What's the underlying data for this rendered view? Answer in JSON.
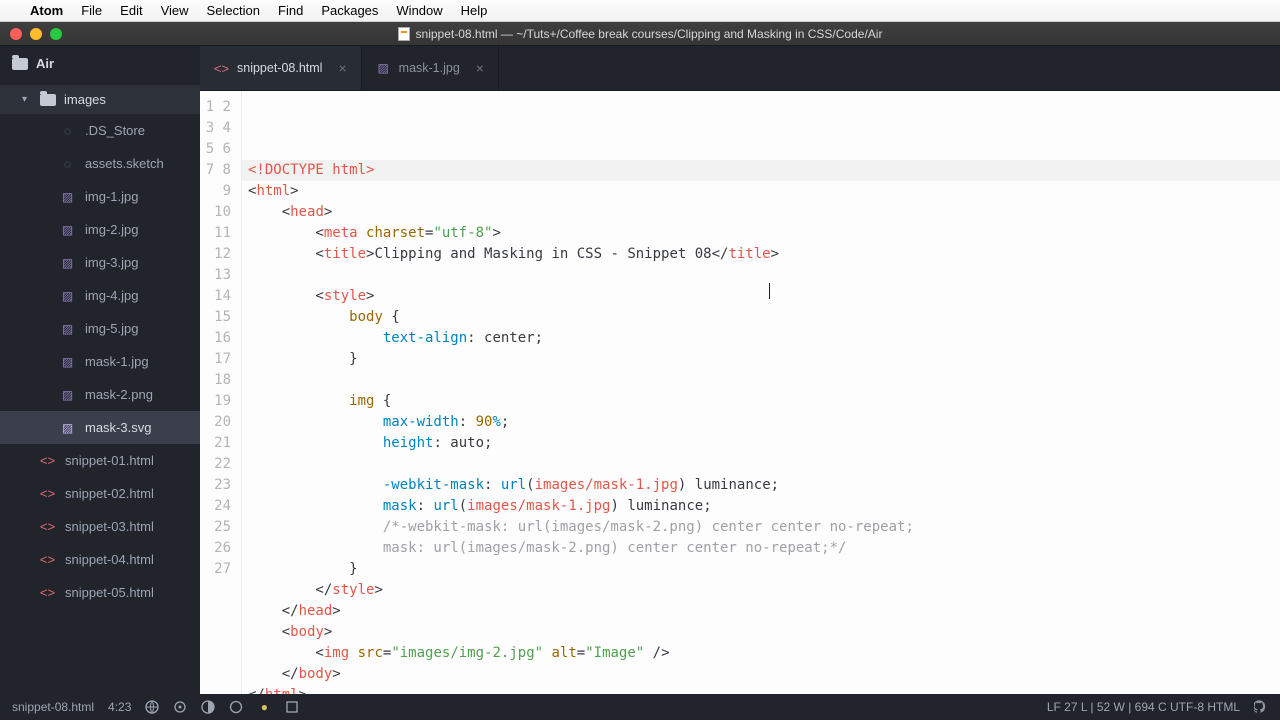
{
  "menubar": {
    "app": "Atom",
    "items": [
      "File",
      "Edit",
      "View",
      "Selection",
      "Find",
      "Packages",
      "Window",
      "Help"
    ]
  },
  "window": {
    "title": "snippet-08.html — ~/Tuts+/Coffee break courses/Clipping and Masking in CSS/Code/Air"
  },
  "sidebar": {
    "root": "Air",
    "folder": "images",
    "images": [
      ".DS_Store",
      "assets.sketch",
      "img-1.jpg",
      "img-2.jpg",
      "img-3.jpg",
      "img-4.jpg",
      "img-5.jpg",
      "mask-1.jpg",
      "mask-2.png",
      "mask-3.svg"
    ],
    "snippets": [
      "snippet-01.html",
      "snippet-02.html",
      "snippet-03.html",
      "snippet-04.html",
      "snippet-05.html"
    ]
  },
  "tabs": [
    {
      "label": "snippet-08.html",
      "icon": "html",
      "active": true
    },
    {
      "label": "mask-1.jpg",
      "icon": "img",
      "active": false
    }
  ],
  "code": {
    "doctype": "<!DOCTYPE html>",
    "charset": "\"utf-8\"",
    "title_text": "Clipping and Masking in CSS - Snippet 08",
    "body_sel": "body",
    "text_align_prop": "text-align",
    "text_align_val": "center",
    "img_sel": "img",
    "max_width_prop": "max-width",
    "max_width_val": "90",
    "height_prop": "height",
    "height_val": "auto",
    "wm_prop": "-webkit-mask",
    "mask_prop": "mask",
    "mask_url": "images/mask-1.jpg",
    "mask_mode": "luminance",
    "cmt1": "/*-webkit-mask: url(images/mask-2.png) center center no-repeat;",
    "cmt2": "mask: url(images/mask-2.png) center center no-repeat;*/",
    "img_src": "\"images/img-2.jpg\"",
    "img_alt": "\"Image\""
  },
  "statusbar": {
    "file": "snippet-08.html",
    "pos": "4:23",
    "right": "LF   27 L | 52 W | 694 C   UTF-8   HTML"
  }
}
